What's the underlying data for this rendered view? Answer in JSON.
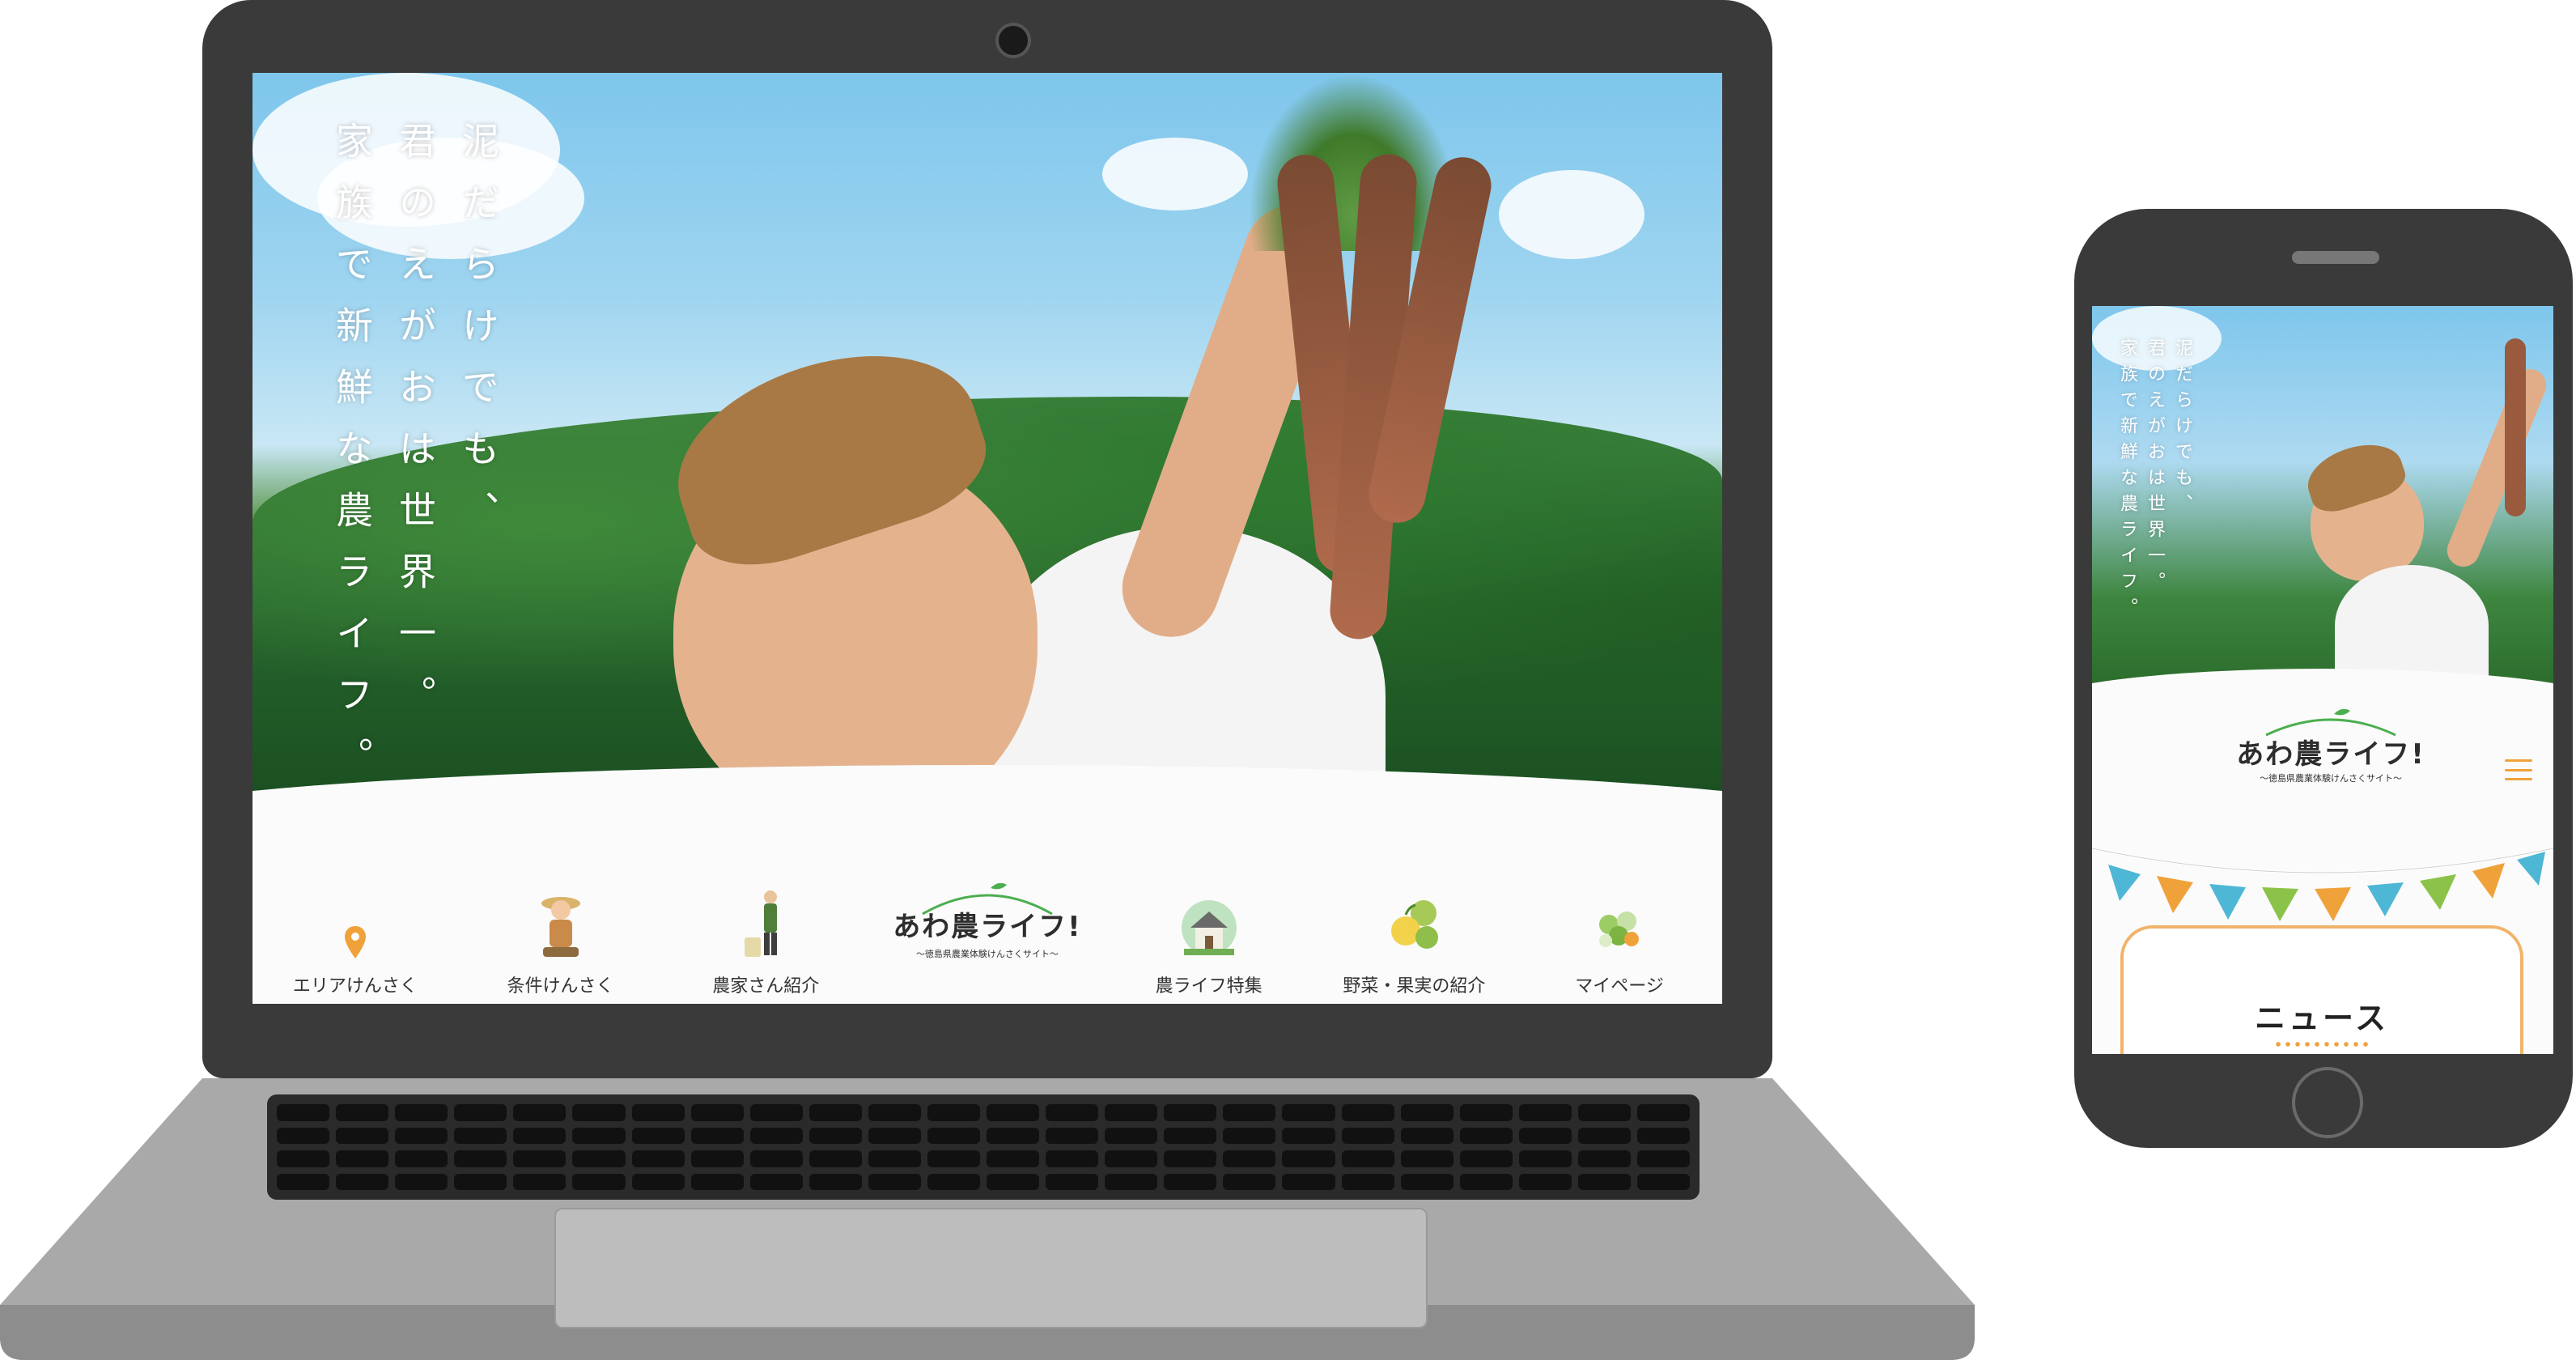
{
  "hero": {
    "catchphrase_lines": [
      "泥だらけでも、",
      "君のえがおは世界一。",
      "家族で新鮮な農ライフ。"
    ]
  },
  "nav": {
    "items": [
      {
        "label": "エリアけんさく",
        "icon": "map-pin-icon"
      },
      {
        "label": "条件けんさく",
        "icon": "farmer-girl-icon"
      },
      {
        "label": "農家さん紹介",
        "icon": "farmer-icon"
      },
      {
        "label": "農ライフ特集",
        "icon": "farmhouse-icon"
      },
      {
        "label": "野菜・果実の紹介",
        "icon": "vegetables-icon"
      },
      {
        "label": "マイページ",
        "icon": "flower-bouquet-icon"
      }
    ]
  },
  "logo": {
    "title": "あわ農ライフ!",
    "subtitle": "〜徳島県農業体験けんさくサイト〜"
  },
  "mobile": {
    "news_title": "ニュース"
  },
  "colors": {
    "accent_orange": "#f0a23a",
    "logo_green": "#4cae4f",
    "bunting": [
      "#f0a23a",
      "#4fb7d6",
      "#8bc34a",
      "#f0a23a",
      "#4fb7d6"
    ]
  }
}
